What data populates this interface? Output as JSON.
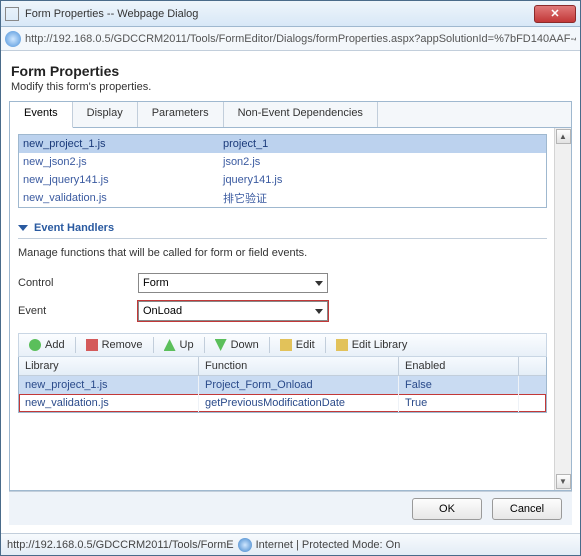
{
  "window": {
    "title": "Form Properties -- Webpage Dialog"
  },
  "address": {
    "url": "http://192.168.0.5/GDCCRM2011/Tools/FormEditor/Dialogs/formProperties.aspx?appSolutionId=%7bFD140AAF-4DF4"
  },
  "header": {
    "title": "Form Properties",
    "subtitle": "Modify this form's properties."
  },
  "tabs": [
    "Events",
    "Display",
    "Parameters",
    "Non-Event Dependencies"
  ],
  "libraries": [
    {
      "file": "new_project_1.js",
      "name": "project_1"
    },
    {
      "file": "new_json2.js",
      "name": "json2.js"
    },
    {
      "file": "new_jquery141.js",
      "name": "jquery141.js"
    },
    {
      "file": "new_validation.js",
      "name": "排它验证"
    }
  ],
  "eventHandlers": {
    "sectionTitle": "Event Handlers",
    "description": "Manage functions that will be called for form or field events.",
    "controlLabel": "Control",
    "controlValue": "Form",
    "eventLabel": "Event",
    "eventValue": "OnLoad"
  },
  "toolbar": {
    "add": "Add",
    "remove": "Remove",
    "up": "Up",
    "down": "Down",
    "edit": "Edit",
    "editLibrary": "Edit Library"
  },
  "grid": {
    "headers": {
      "library": "Library",
      "function": "Function",
      "enabled": "Enabled"
    },
    "rows": [
      {
        "library": "new_project_1.js",
        "function": "Project_Form_Onload",
        "enabled": "False"
      },
      {
        "library": "new_validation.js",
        "function": "getPreviousModificationDate",
        "enabled": "True"
      }
    ]
  },
  "buttons": {
    "ok": "OK",
    "cancel": "Cancel"
  },
  "status": {
    "path": "http://192.168.0.5/GDCCRM2011/Tools/FormE",
    "zone": "Internet | Protected Mode: On"
  }
}
